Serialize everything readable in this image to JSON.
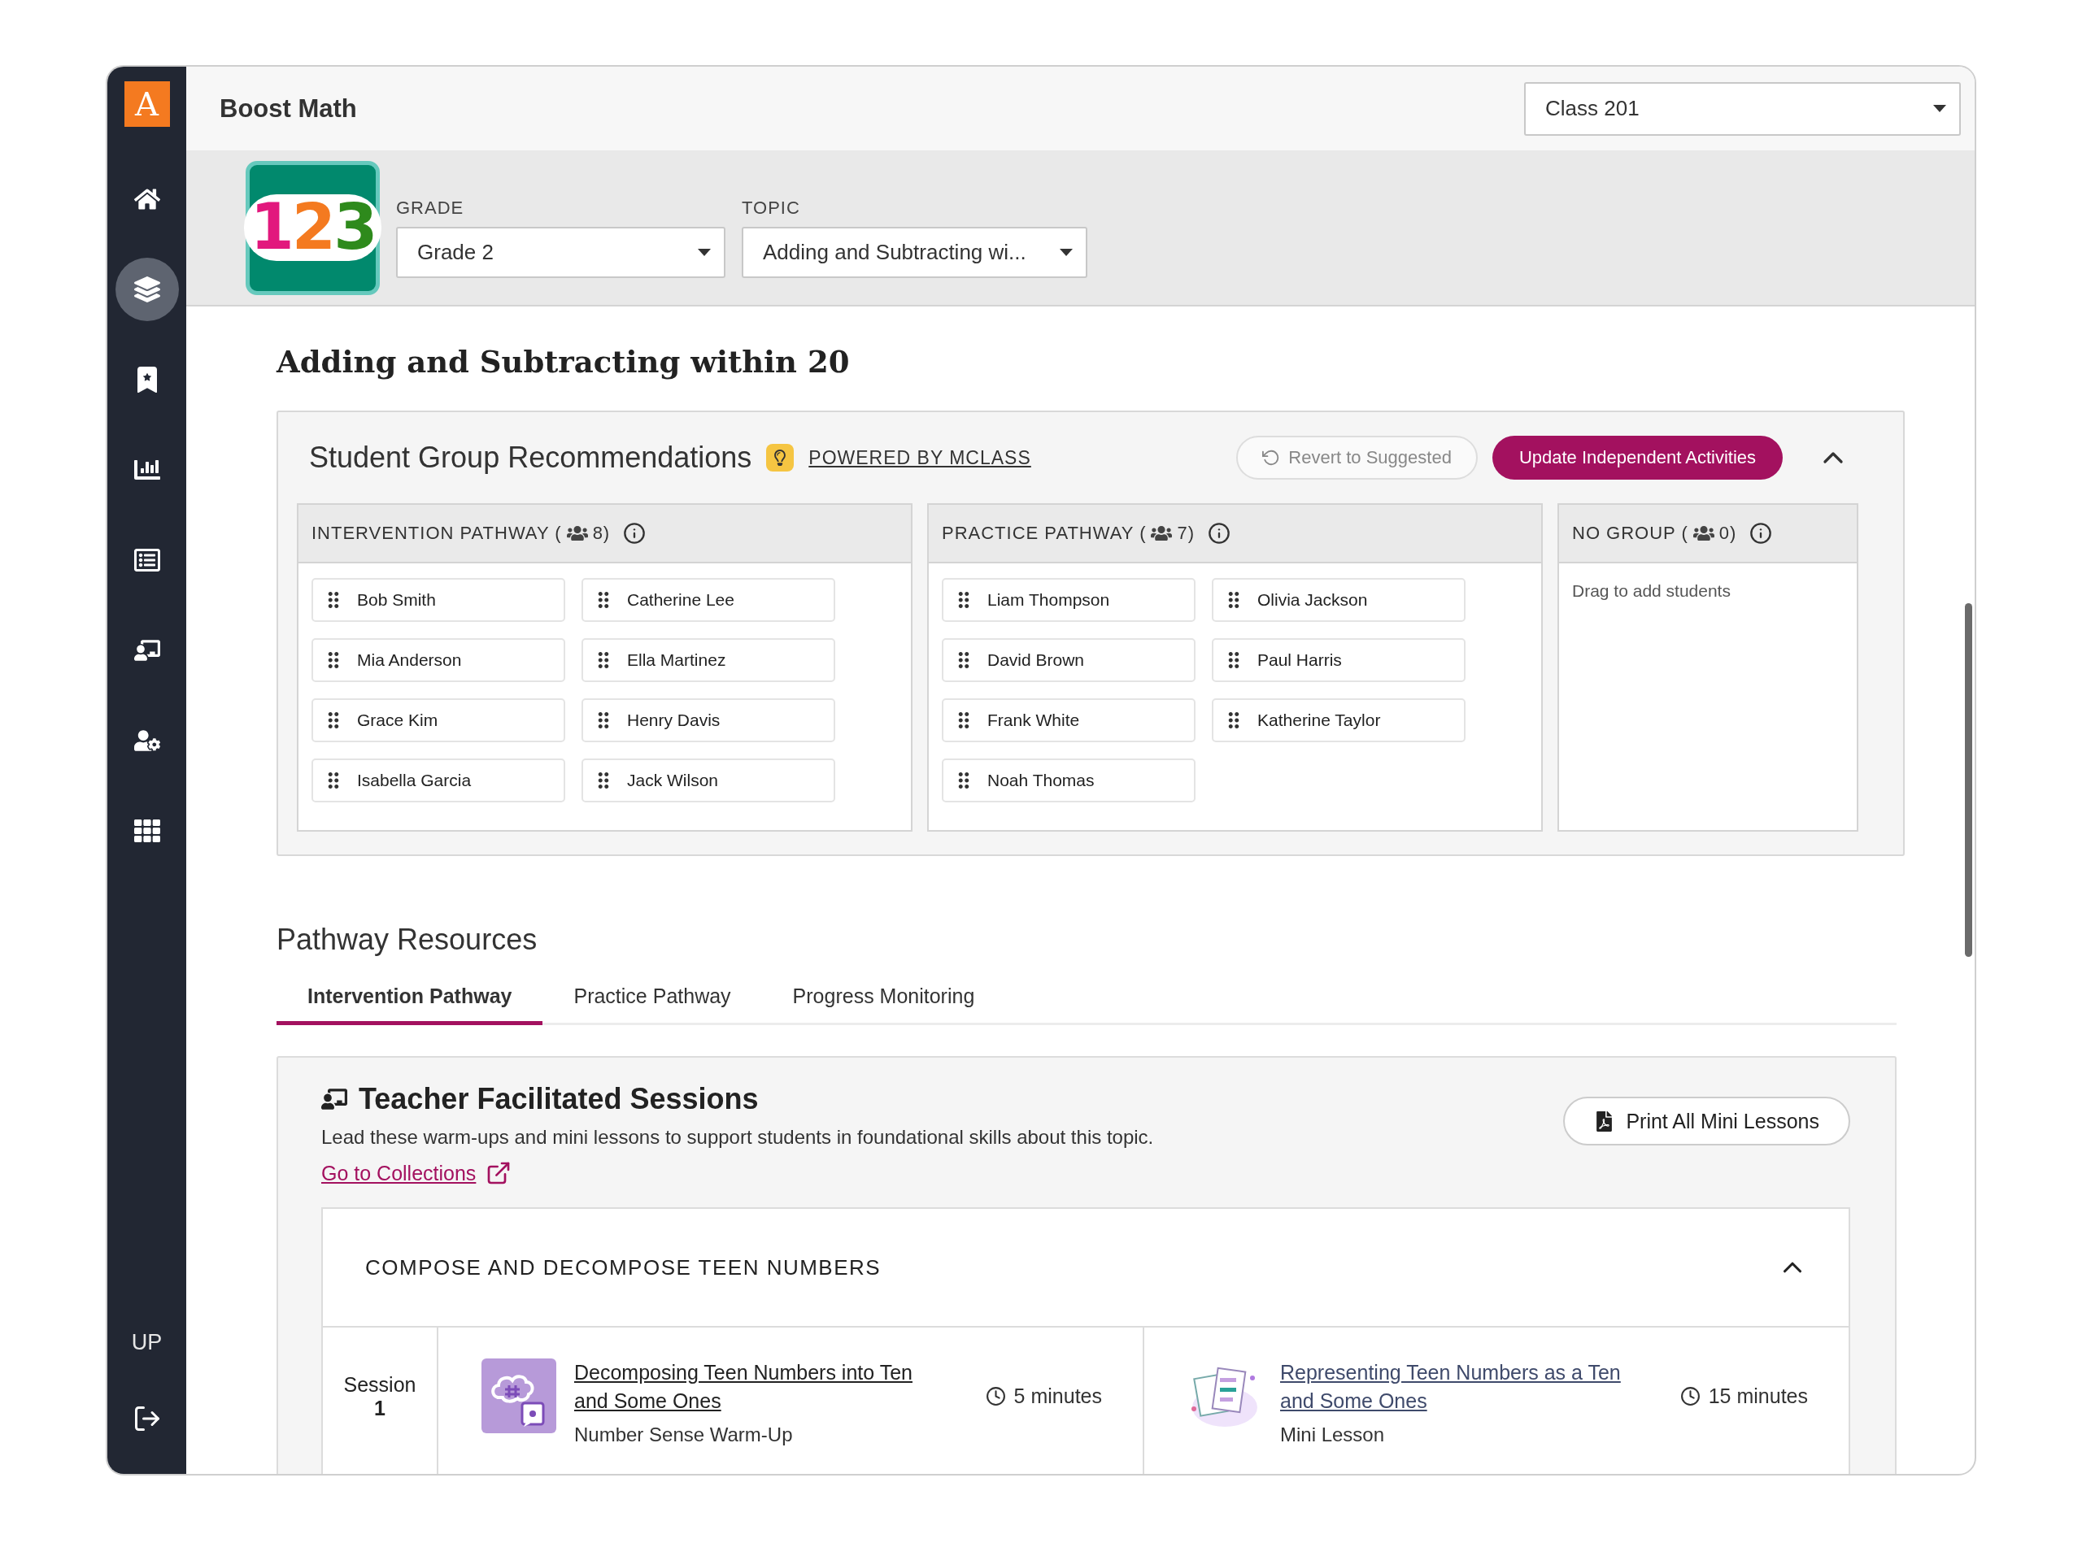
{
  "app": {
    "logo": "A",
    "title": "Boost Math"
  },
  "sidebar": {
    "items": [
      {
        "selected": false
      },
      {
        "selected": true
      },
      {
        "selected": false
      },
      {
        "selected": false
      },
      {
        "selected": false
      },
      {
        "selected": false
      },
      {
        "selected": false
      },
      {
        "selected": false
      }
    ],
    "initials": "UP"
  },
  "class_select": {
    "value": "Class 201"
  },
  "filters": {
    "logo": "123",
    "grade": {
      "label": "GRADE",
      "value": "Grade 2"
    },
    "topic": {
      "label": "TOPIC",
      "value": "Adding and Subtracting wi..."
    }
  },
  "page_title": "Adding and Subtracting within 20",
  "groups_panel": {
    "title": "Student Group Recommendations",
    "powered_by": "POWERED BY MCLASS",
    "revert_button": "Revert to Suggested",
    "update_button": "Update Independent Activities",
    "expanded": true,
    "groups": [
      {
        "label": "INTERVENTION PATHWAY (",
        "count": "8)",
        "students": [
          "Bob Smith",
          "Catherine Lee",
          "Mia Anderson",
          "Ella Martinez",
          "Grace Kim",
          "Henry Davis",
          "Isabella Garcia",
          "Jack Wilson"
        ]
      },
      {
        "label": "PRACTICE PATHWAY (",
        "count": "7)",
        "students": [
          "Liam Thompson",
          "Olivia Jackson",
          "David Brown",
          "Paul Harris",
          "Frank White",
          "Katherine Taylor",
          "Noah Thomas"
        ]
      },
      {
        "label": "NO GROUP (",
        "count": "0)",
        "empty_hint": "Drag to add students"
      }
    ]
  },
  "resources": {
    "title": "Pathway Resources",
    "tabs": [
      {
        "label": "Intervention Pathway",
        "selected": true
      },
      {
        "label": "Practice Pathway",
        "selected": false
      },
      {
        "label": "Progress Monitoring",
        "selected": false
      }
    ]
  },
  "sessions_card": {
    "title": "Teacher Facilitated Sessions",
    "description": "Lead these warm-ups and mini lessons to support students in foundational skills about this topic.",
    "link": "Go to Collections",
    "print_button": "Print All Mini Lessons",
    "section": {
      "title": "COMPOSE AND DECOMPOSE TEEN NUMBERS",
      "expanded": true,
      "sessions": [
        {
          "label": "Session",
          "number": "1",
          "activities": [
            {
              "kind": "warm-up",
              "title": "Decomposing Teen Numbers into Ten and Some Ones",
              "type": "Number Sense Warm-Up",
              "duration": "5 minutes"
            },
            {
              "kind": "mini-lesson",
              "title": "Representing Teen Numbers as a Ten and Some Ones",
              "type": "Mini Lesson",
              "duration": "15 minutes"
            }
          ]
        }
      ]
    }
  }
}
